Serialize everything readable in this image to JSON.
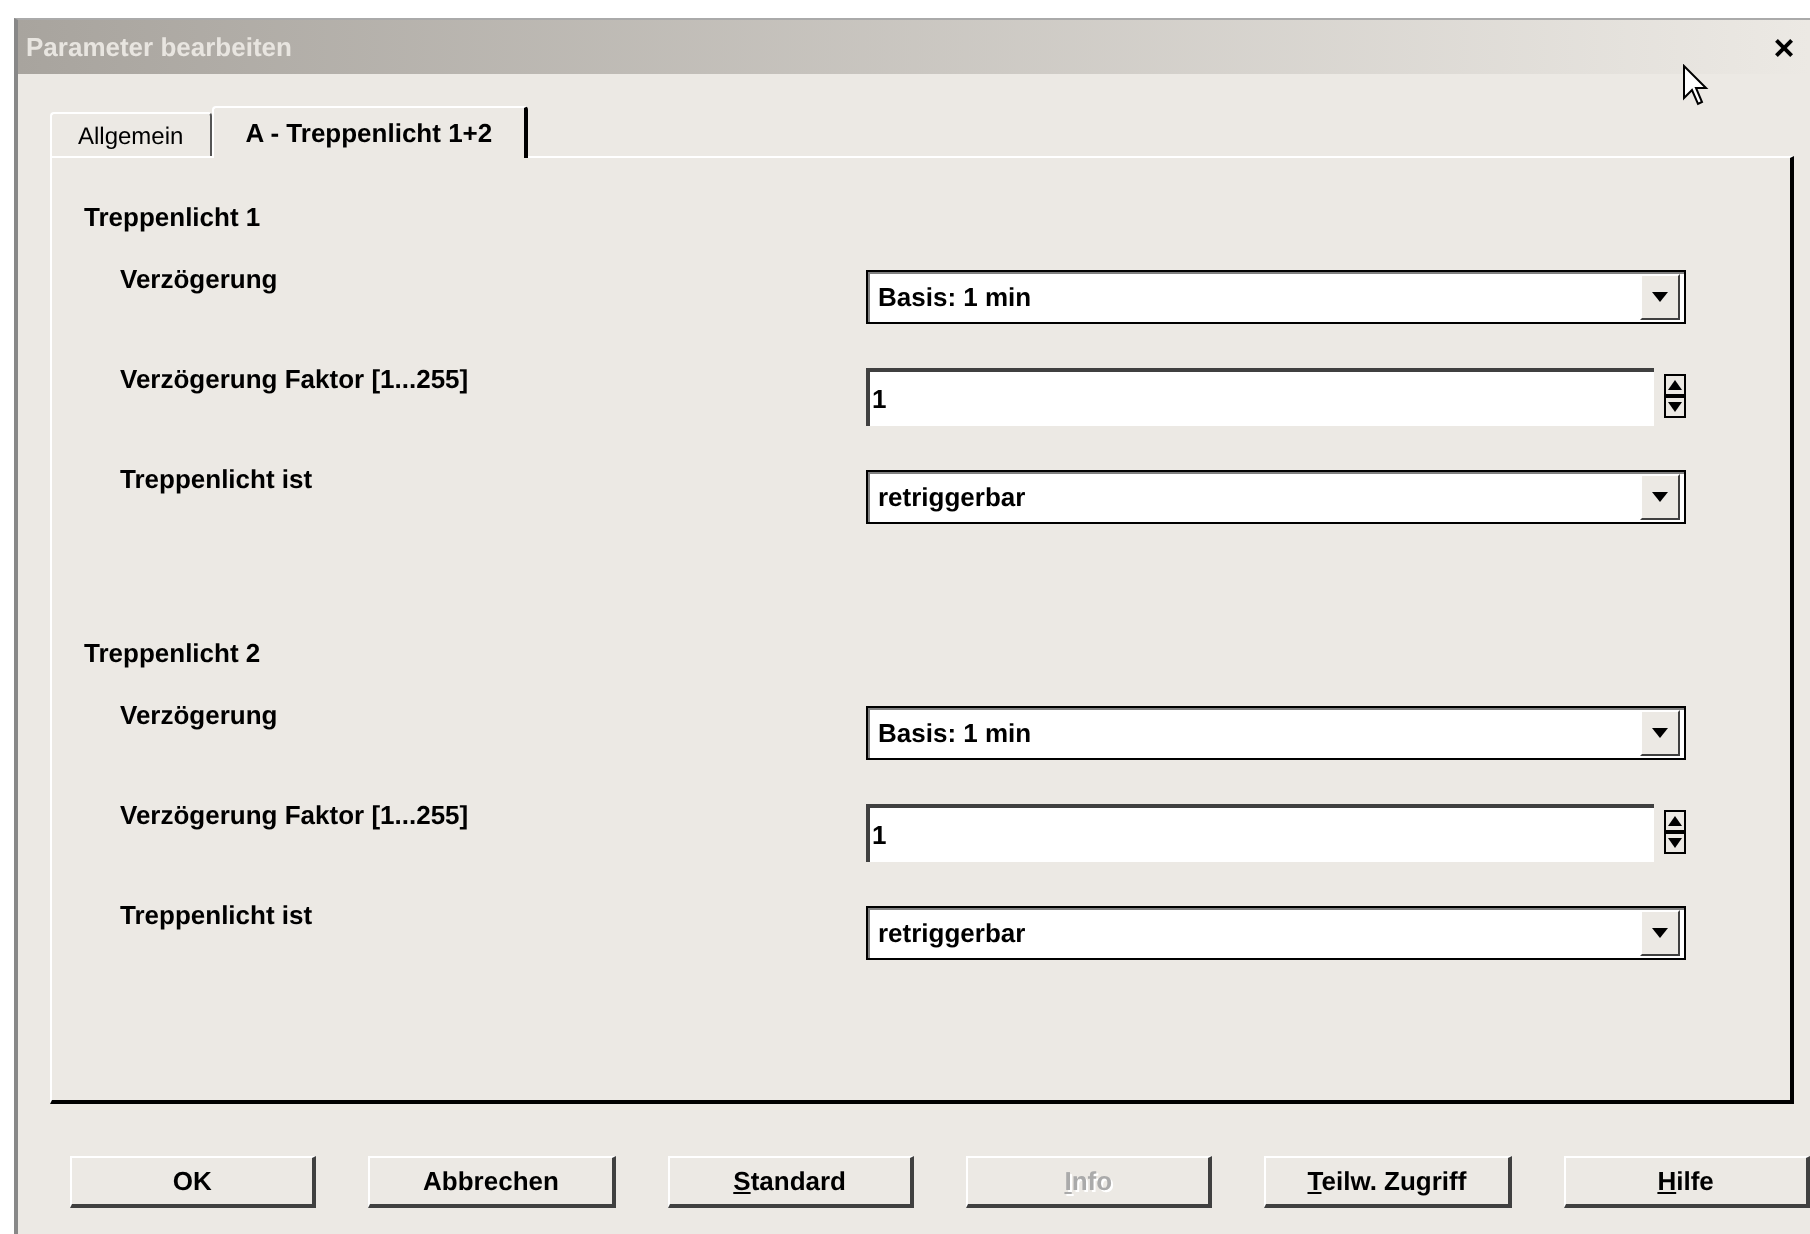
{
  "window": {
    "title": "Parameter bearbeiten",
    "close": "×"
  },
  "tabs": [
    {
      "label": "Allgemein",
      "selected": false
    },
    {
      "label": "A - Treppenlicht 1+2",
      "selected": true
    }
  ],
  "sections": [
    {
      "title": "Treppenlicht 1",
      "rows": [
        {
          "label": "Verzögerung",
          "kind": "dropdown",
          "value": "Basis: 1 min"
        },
        {
          "label": "Verzögerung Faktor [1...255]",
          "kind": "spinner",
          "value": "1"
        },
        {
          "label": "Treppenlicht ist",
          "kind": "dropdown",
          "value": "retriggerbar"
        }
      ]
    },
    {
      "title": "Treppenlicht 2",
      "rows": [
        {
          "label": "Verzögerung",
          "kind": "dropdown",
          "value": "Basis: 1 min"
        },
        {
          "label": "Verzögerung Faktor [1...255]",
          "kind": "spinner",
          "value": "1"
        },
        {
          "label": "Treppenlicht ist",
          "kind": "dropdown",
          "value": "retriggerbar"
        }
      ]
    }
  ],
  "buttons": [
    {
      "label": "OK",
      "underline_first": false,
      "disabled": false
    },
    {
      "label": "Abbrechen",
      "underline_first": false,
      "disabled": false
    },
    {
      "label": "Standard",
      "underline_first": true,
      "disabled": false
    },
    {
      "label": "Info",
      "underline_first": true,
      "disabled": true
    },
    {
      "label": "Teilw. Zugriff",
      "underline_first": true,
      "disabled": false
    },
    {
      "label": "Hilfe",
      "underline_first": true,
      "disabled": false
    }
  ]
}
